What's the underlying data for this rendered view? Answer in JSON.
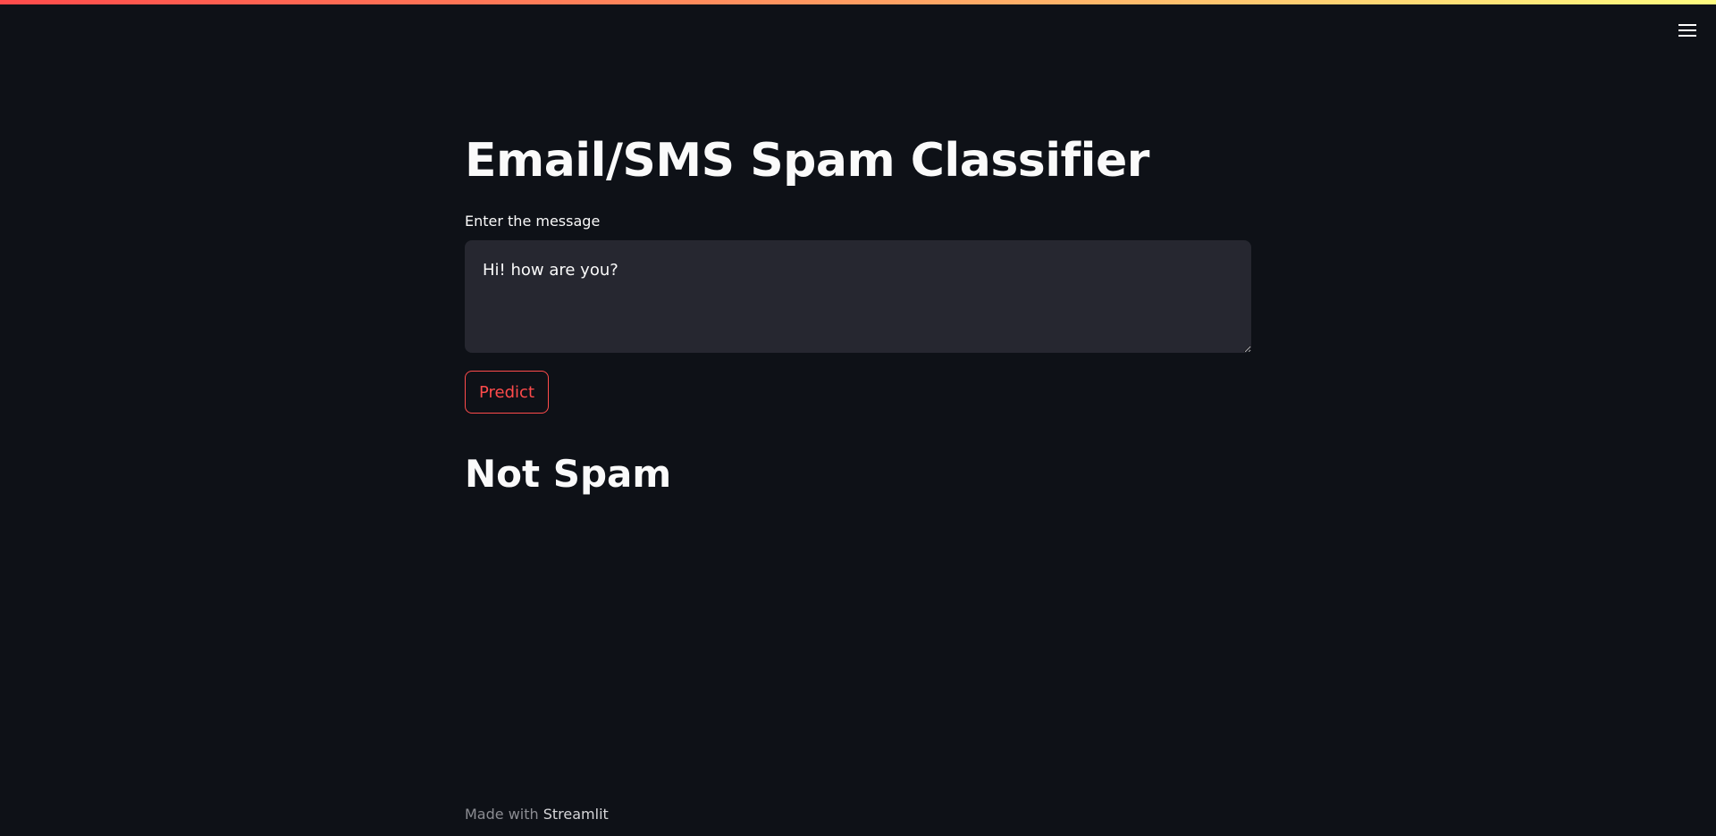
{
  "app": {
    "title": "Email/SMS Spam Classifier"
  },
  "input": {
    "label": "Enter the message",
    "value": "Hi! how are you?"
  },
  "actions": {
    "predict_label": "Predict"
  },
  "result": {
    "text": "Not Spam"
  },
  "footer": {
    "made_with": "Made with",
    "brand": "Streamlit"
  },
  "icons": {
    "menu": "hamburger-menu-icon"
  },
  "colors": {
    "background": "#0e1117",
    "accent": "#ff4b4b",
    "input_background": "#262730",
    "text": "#fafafa"
  }
}
